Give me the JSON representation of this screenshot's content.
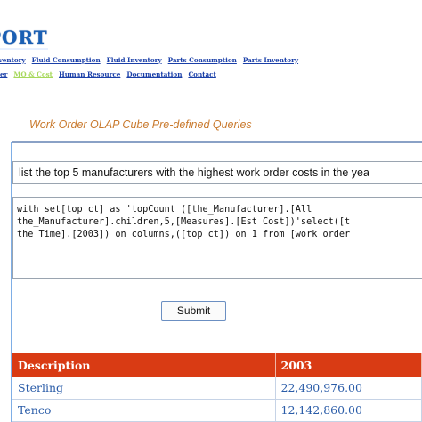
{
  "logo_text": "PORT",
  "nav_row1": [
    {
      "label": "Inventory",
      "active": false
    },
    {
      "label": "Fluid Consumption",
      "active": false
    },
    {
      "label": "Fluid Inventory",
      "active": false
    },
    {
      "label": "Parts Consumption",
      "active": false
    },
    {
      "label": "Parts Inventory",
      "active": false
    }
  ],
  "nav_row2": [
    {
      "label": "der",
      "active": false
    },
    {
      "label": "MO & Cost",
      "active": true
    },
    {
      "label": "Human Resource",
      "active": false
    },
    {
      "label": "Documentation",
      "active": false
    },
    {
      "label": "Contact",
      "active": false
    }
  ],
  "section_title": "Work Order OLAP Cube Pre-defined Queries",
  "question_text": "list the top 5 manufacturers with the highest work order costs in the yea",
  "query_lines": [
    "with set[top ct] as 'topCount ([the_Manufacturer].[All",
    "the_Manufacturer].children,5,[Measures].[Est Cost])'select([t",
    "the_Time].[2003]) on columns,([top ct]) on 1 from [work order"
  ],
  "submit_label": "Submit",
  "results": {
    "headers": [
      "Description",
      "2003"
    ],
    "rows": [
      [
        "Sterling",
        "22,490,976.00"
      ],
      [
        "Tenco",
        "12,142,860.00"
      ]
    ]
  },
  "colors": {
    "header_bg": "#d93b14",
    "link": "#1a3fa8",
    "active_link": "#a6d85a",
    "title": "#c97a2e",
    "cell_text": "#2a5ca8"
  }
}
